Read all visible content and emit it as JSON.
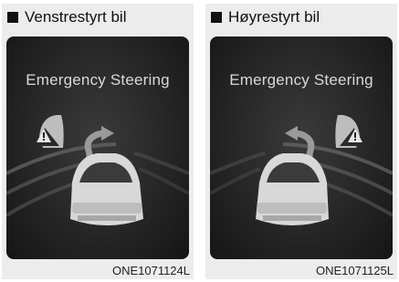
{
  "figures": [
    {
      "heading": "Venstrestyrt bil",
      "screen_title": "Emergency Steering",
      "code": "ONE1071124L",
      "obstacle_side": "left",
      "swerve_direction": "right"
    },
    {
      "heading": "Høyrestyrt bil",
      "screen_title": "Emergency Steering",
      "code": "ONE1071125L",
      "obstacle_side": "right",
      "swerve_direction": "left"
    }
  ]
}
